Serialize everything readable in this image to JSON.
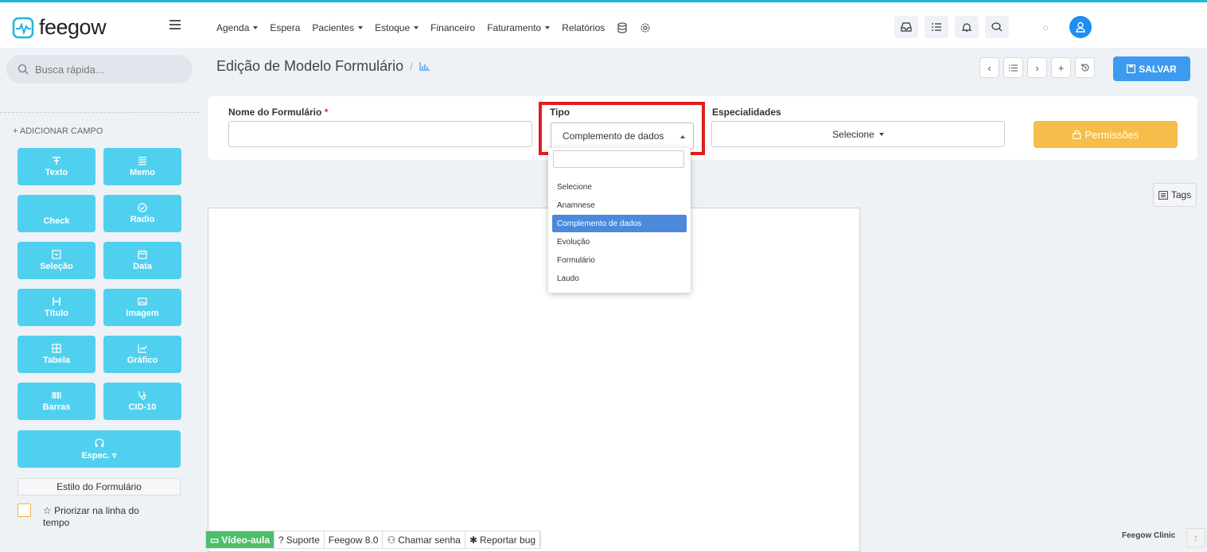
{
  "app": {
    "logo_text": "feegow",
    "brand_color": "#1fb6d8",
    "accent": "#3c9bef"
  },
  "nav": {
    "items": [
      {
        "label": "Agenda",
        "caret": true
      },
      {
        "label": "Espera",
        "caret": false
      },
      {
        "label": "Pacientes",
        "caret": true
      },
      {
        "label": "Estoque",
        "caret": true
      },
      {
        "label": "Financeiro",
        "caret": false
      },
      {
        "label": "Faturamento",
        "caret": true
      },
      {
        "label": "Relatórios",
        "caret": false
      }
    ],
    "extra_icons": [
      "database-icon",
      "gear-icon"
    ],
    "right_icons": [
      "inbox-icon",
      "task-list-icon",
      "bell-icon",
      "chat-icon"
    ]
  },
  "sidebar": {
    "search_placeholder": "Busca rápida...",
    "add_field_label": "+ ADICIONAR CAMPO",
    "fields": [
      {
        "label": "Texto",
        "icon": "text-icon"
      },
      {
        "label": "Memo",
        "icon": "lines-icon"
      },
      {
        "label": "Check",
        "icon": ""
      },
      {
        "label": "Radio",
        "icon": "radio-icon"
      },
      {
        "label": "Seleção",
        "icon": "select-icon"
      },
      {
        "label": "Data",
        "icon": "calendar-icon"
      },
      {
        "label": "Título",
        "icon": "heading-icon"
      },
      {
        "label": "Imagem",
        "icon": "image-icon"
      },
      {
        "label": "Tabela",
        "icon": "table-icon"
      },
      {
        "label": "Gráfico",
        "icon": "chart-icon"
      },
      {
        "label": "Barras",
        "icon": "barcode-icon"
      },
      {
        "label": "CID-10",
        "icon": "stethoscope-icon"
      }
    ],
    "espec_label": "Espec.",
    "style_button": "Estilo do Formulário",
    "prioritize_label": "Priorizar na linha do tempo"
  },
  "page": {
    "title": "Edição de Modelo Formulário",
    "separator": "/",
    "save_label": "SALVAR"
  },
  "form": {
    "name_label": "Nome do Formulário",
    "name_required": "*",
    "name_value": "",
    "type_label": "Tipo",
    "type_value": "Complemento de dados",
    "specialties_label": "Especialidades",
    "specialties_value": "Selecione",
    "permissions_label": "Permissões"
  },
  "dropdown": {
    "search_value": "",
    "options": [
      "Selecione",
      "Anamnese",
      "Complemento de dados",
      "Evolução",
      "Formulário",
      "Laudo"
    ],
    "selected_index": 2
  },
  "tags_label": "Tags",
  "bottom_bar": {
    "items": [
      "Vídeo-aula",
      "Suporte",
      "Feegow 8.0",
      "Chamar senha",
      "Reportar bug"
    ]
  },
  "footer_brand": "Feegow Clinic"
}
